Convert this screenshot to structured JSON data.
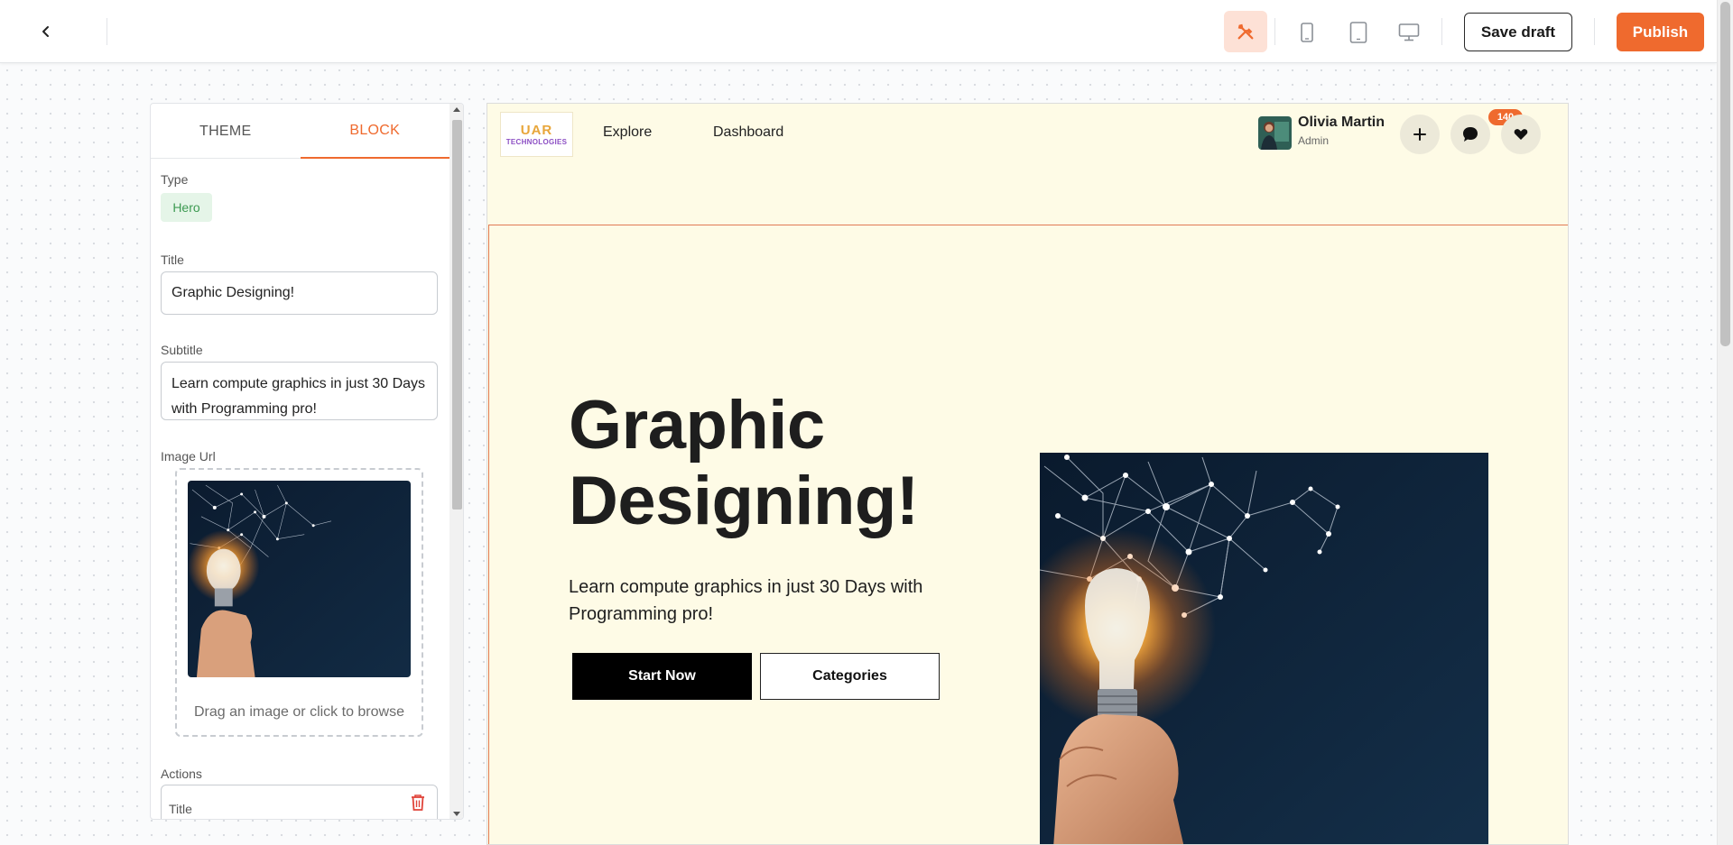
{
  "toolbar": {
    "save_draft_label": "Save draft",
    "publish_label": "Publish",
    "accent_color": "#ef6a2e"
  },
  "panel": {
    "tabs": [
      {
        "label": "THEME",
        "active": false
      },
      {
        "label": "BLOCK",
        "active": true
      }
    ],
    "type_label": "Type",
    "type_value": "Hero",
    "title_label": "Title",
    "title_value": "Graphic Designing!",
    "subtitle_label": "Subtitle",
    "subtitle_value": "Learn compute graphics in just 30 Days with Programming pro!",
    "image_url_label": "Image Url",
    "dropzone_text": "Drag an image or click to browse",
    "actions_label": "Actions",
    "action_title_placeholder": "Title"
  },
  "preview": {
    "logo": {
      "line1": "UAR",
      "line2": "TECHNOLOGIES"
    },
    "nav": [
      "Explore",
      "Dashboard"
    ],
    "user": {
      "name": "Olivia Martin",
      "role": "Admin"
    },
    "messages_count": "140",
    "hero": {
      "title": "Graphic Designing!",
      "subtitle": "Learn compute graphics in just 30 Days with Programming pro!",
      "primary_button": "Start Now",
      "secondary_button": "Categories"
    },
    "background_color": "#fefbe6"
  }
}
